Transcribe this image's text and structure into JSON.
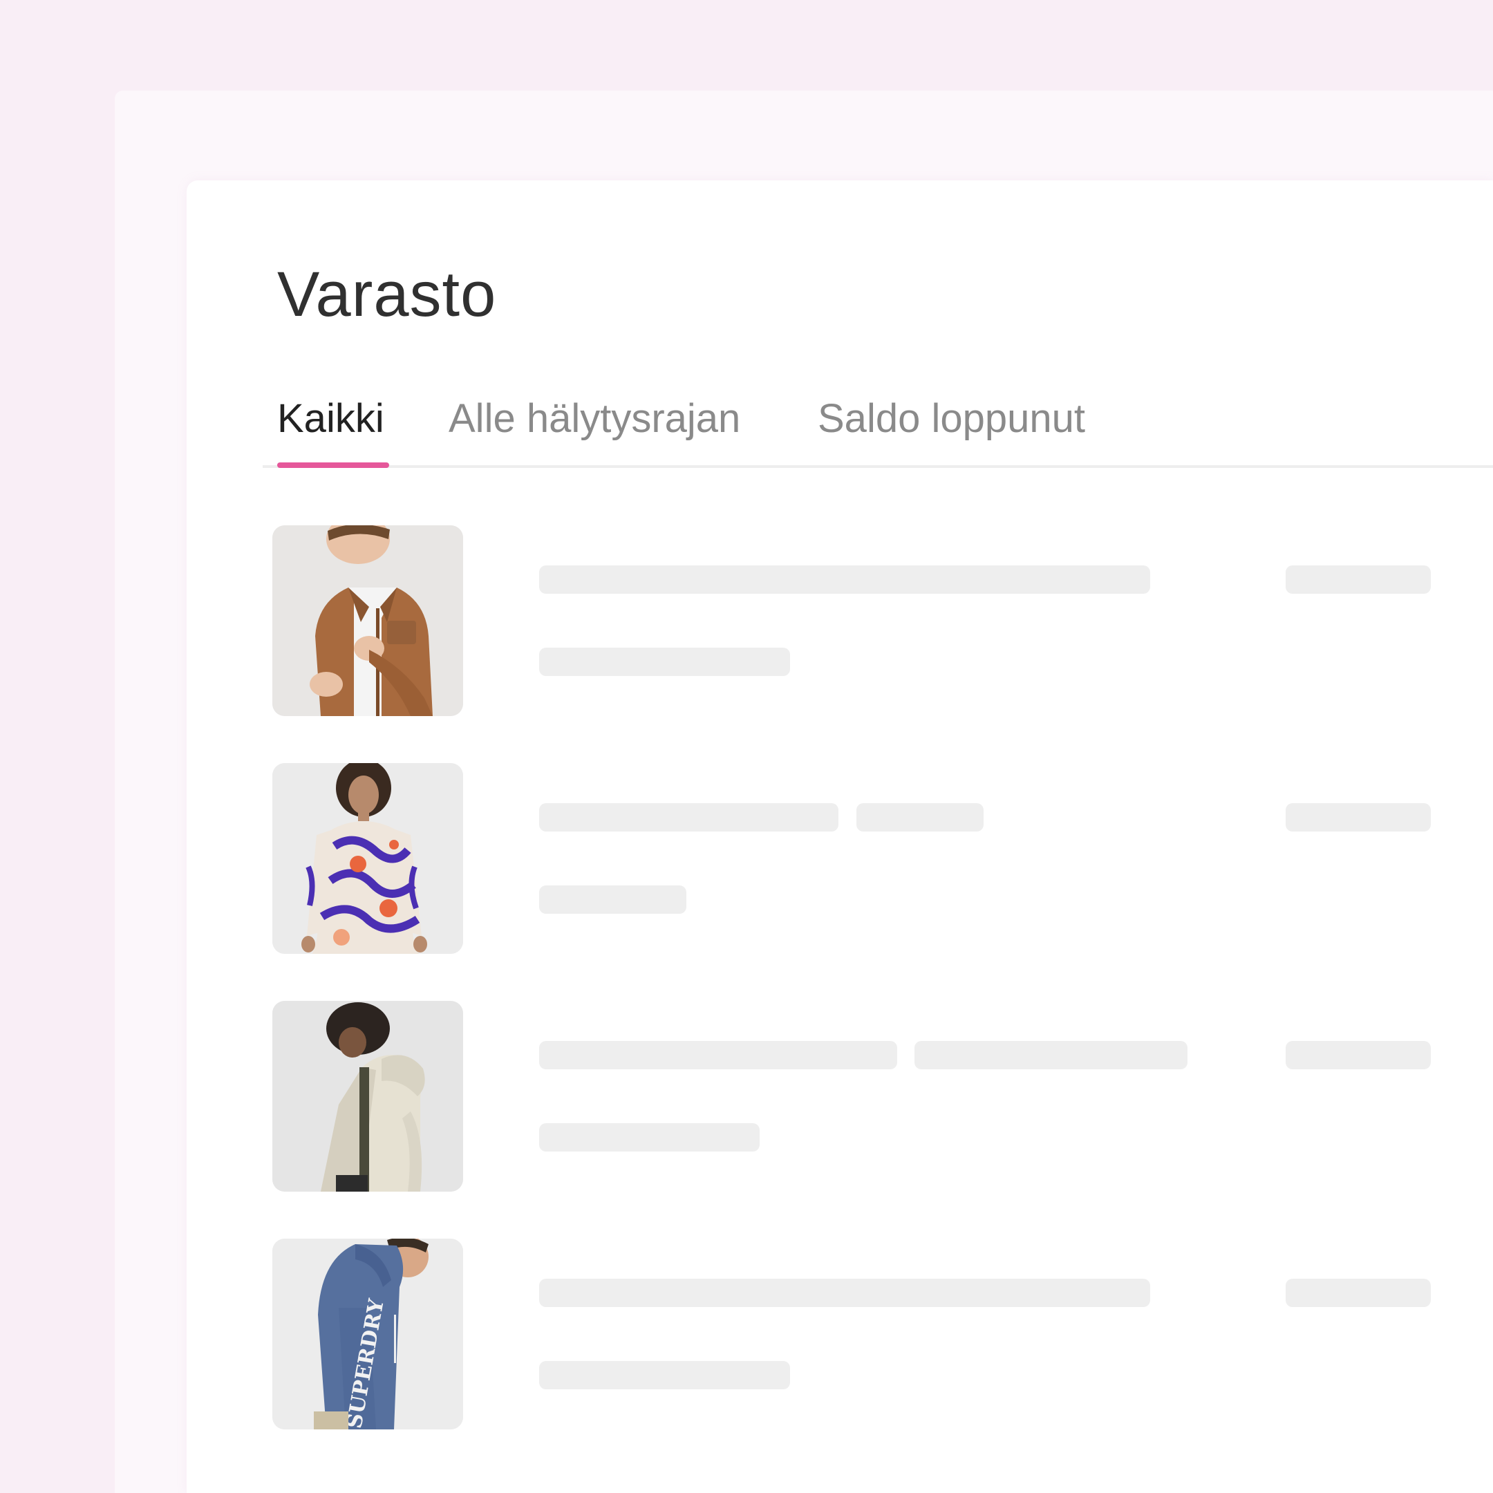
{
  "page": {
    "title": "Varasto"
  },
  "tabs": [
    {
      "label": "Kaikki",
      "active": true
    },
    {
      "label": "Alle hälytysrajan",
      "active": false
    },
    {
      "label": "Saldo loppunut",
      "active": false
    }
  ],
  "colors": {
    "background": "#f9eef6",
    "accent": "#e5579a",
    "skeleton": "#eeeeee",
    "title_text": "#303030",
    "inactive_tab_text": "#8a8a8a"
  },
  "products": [
    {
      "image": "brown-suede-jacket-photo",
      "loading": true
    },
    {
      "image": "patterned-dress-photo",
      "loading": true
    },
    {
      "image": "cream-hooded-jacket-photo",
      "loading": true
    },
    {
      "image": "blue-hoodie-photo",
      "loading": true,
      "image_text": "SUPERDRY"
    }
  ]
}
